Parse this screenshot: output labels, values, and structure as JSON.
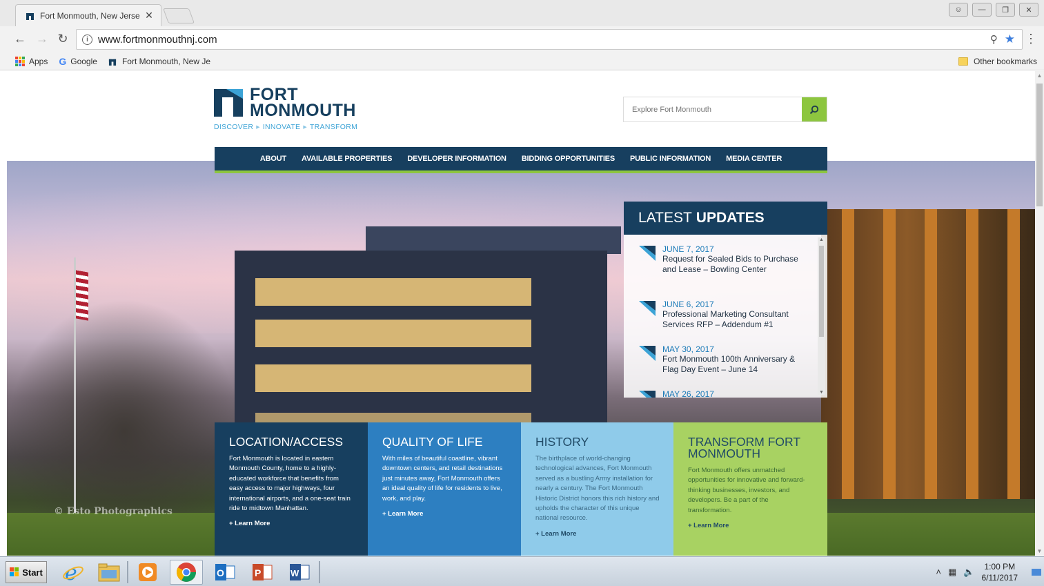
{
  "browser": {
    "tab_title": "Fort Monmouth, New Jerse",
    "url": "www.fortmonmouthnj.com",
    "bookmarks": [
      {
        "label": "Apps"
      },
      {
        "label": "Google"
      },
      {
        "label": "Fort Monmouth, New Je"
      }
    ],
    "other_bookmarks": "Other bookmarks"
  },
  "site": {
    "logo_line1": "FORT",
    "logo_line2": "MONMOUTH",
    "tagline": [
      "DISCOVER",
      "INNOVATE",
      "TRANSFORM"
    ],
    "search_placeholder": "Explore Fort Monmouth",
    "nav": [
      "ABOUT",
      "AVAILABLE PROPERTIES",
      "DEVELOPER INFORMATION",
      "BIDDING OPPORTUNITIES",
      "PUBLIC INFORMATION",
      "MEDIA CENTER"
    ],
    "photo_credit": "© Esto Photographics",
    "updates": {
      "title_light": "LATEST",
      "title_bold": "UPDATES",
      "items": [
        {
          "date": "JUNE 7, 2017",
          "text": "Request for Sealed Bids to Purchase and Lease – Bowling Center"
        },
        {
          "date": "JUNE 6, 2017",
          "text": "Professional Marketing Consultant Services RFP – Addendum #1"
        },
        {
          "date": "MAY 30, 2017",
          "text": "Fort Monmouth 100th Anniversary & Flag Day Event – June 14"
        },
        {
          "date": "MAY 26, 2017",
          "text": ""
        }
      ]
    },
    "panels": [
      {
        "title": "LOCATION/ACCESS",
        "body": "Fort Monmouth is located in eastern Monmouth County, home to a highly-educated workforce that benefits from easy access to major highways, four international airports, and a one-seat train ride to midtown Manhattan.",
        "more": "+ Learn More"
      },
      {
        "title": "QUALITY OF LIFE",
        "body": "With miles of beautiful coastline, vibrant downtown centers, and retail destinations just minutes away, Fort Monmouth offers an ideal quality of life for residents to live, work, and play.",
        "more": "+ Learn More"
      },
      {
        "title": "HISTORY",
        "body": "The birthplace of world-changing technological advances, Fort Monmouth served as a bustling Army installation for nearly a century. The Fort Monmouth Historic District honors this rich history and upholds the character of this unique national resource.",
        "more": "+ Learn More"
      },
      {
        "title": "TRANSFORM FORT MONMOUTH",
        "body": "Fort Monmouth offers unmatched opportunities for innovative and forward-thinking businesses, investors, and developers. Be a part of the transformation.",
        "more": "+ Learn More"
      }
    ]
  },
  "taskbar": {
    "start_label": "Start",
    "time": "1:00 PM",
    "date": "6/11/2017"
  },
  "colors": {
    "navy": "#173f5f",
    "green": "#8dc63f",
    "blue": "#2d7fc1",
    "light_blue": "#8fcbea",
    "lime": "#a8d262"
  }
}
